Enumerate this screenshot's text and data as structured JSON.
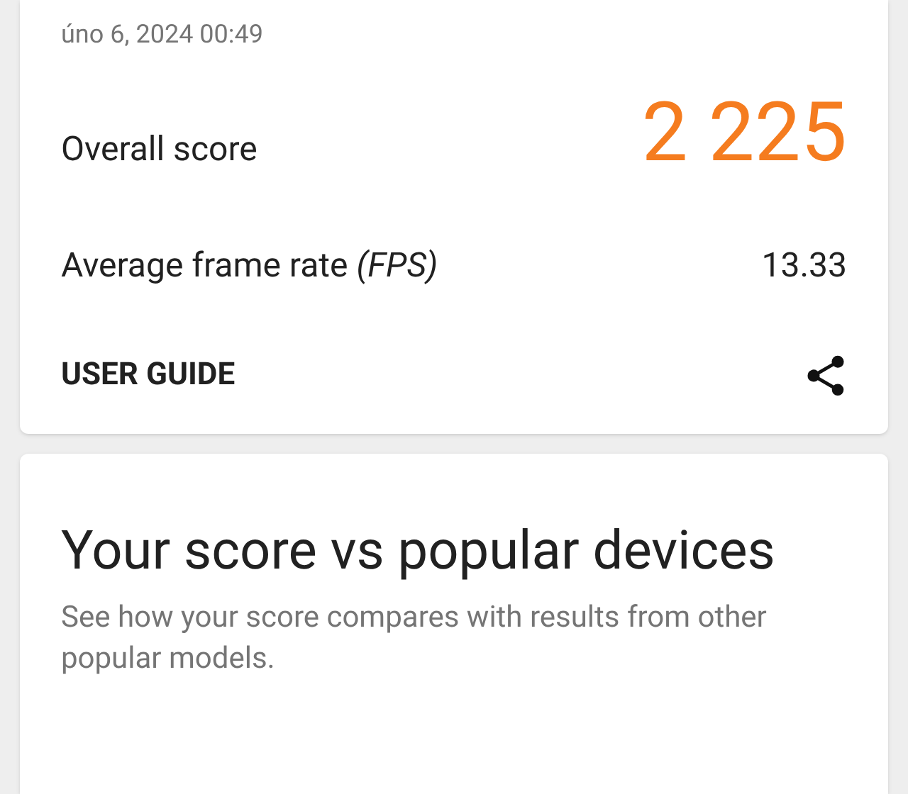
{
  "result_card": {
    "date": "úno 6, 2024 00:49",
    "rows": [
      {
        "kind": "score",
        "label": "Overall score",
        "value": "2 225"
      },
      {
        "kind": "plain",
        "label": "Average frame rate *(FPS)*",
        "value": "13.33"
      }
    ],
    "user_guide": "USER GUIDE"
  },
  "compare_card": {
    "title": "Your score vs popular devices",
    "subtitle": "See how your score compares with results from other popular models."
  }
}
